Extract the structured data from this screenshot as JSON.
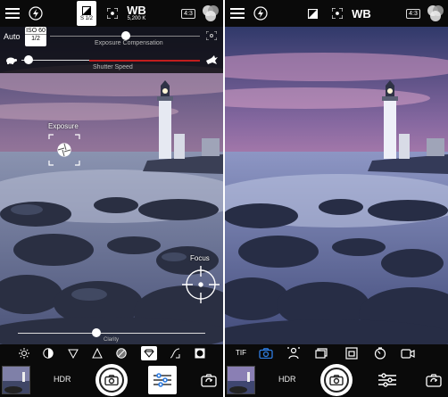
{
  "left": {
    "topbar": {
      "menu_icon": "hamburger-icon",
      "flash_icon": "flash-icon",
      "shutter_mode_label": "S 1/2",
      "focus_frame_icon": "focus-frame-icon",
      "wb_label": "WB",
      "wb_value": "5,200 K",
      "ratio_label": "4:3",
      "filter_icon": "color-circles-icon"
    },
    "controls": {
      "auto_label": "Auto",
      "iso_label": "ISO 60",
      "iso_value": "1/2",
      "exposure_comp_label": "Exposure Compensation",
      "shutter_speed_label": "Shutter Speed",
      "exposure_label": "Exposure",
      "focus_label": "Focus",
      "clarity_label": "Clarity"
    },
    "bottom": {
      "hdr_label": "HDR"
    }
  },
  "right": {
    "topbar": {
      "wb_label": "WB",
      "ratio_label": "4:3"
    },
    "modes": {
      "format_label": "TIF"
    },
    "bottom": {
      "hdr_label": "HDR"
    }
  },
  "colors": {
    "accent_blue": "#2f7de1",
    "shutter_red": "#c21d1d",
    "bar_bg": "#0a0a0a"
  }
}
